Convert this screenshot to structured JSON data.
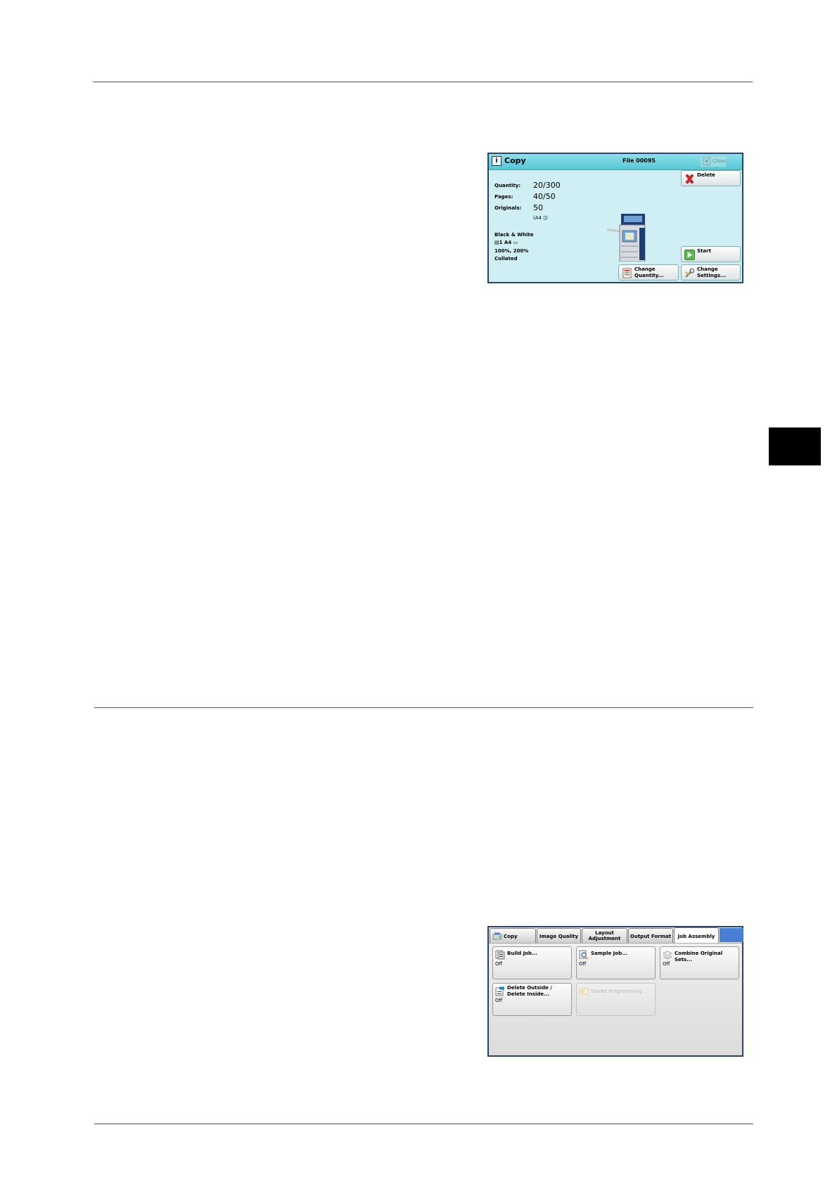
{
  "panel_job": {
    "title": "Copy",
    "file": "File 00095",
    "close_label": "Close",
    "fields": [
      {
        "label": "Quantity:",
        "value": "20/300"
      },
      {
        "label": "Pages:",
        "value": "40/50"
      },
      {
        "label": "Originals:",
        "value": "50"
      }
    ],
    "paper": "(A4 ▯)",
    "settings": [
      "Black & White",
      "▤1    A4 ▭",
      "100%, 200%",
      "Collated"
    ],
    "buttons": {
      "delete": "Delete",
      "start": "Start",
      "change_quantity": [
        "Change",
        "Quantity..."
      ],
      "change_settings": [
        "Change",
        "Settings..."
      ]
    }
  },
  "panel_tabs": {
    "tabs": [
      "Copy",
      "Image Quality",
      [
        "Layout",
        "Adjustment"
      ],
      "Output Format",
      "Job Assembly"
    ],
    "buttons": [
      {
        "label": "Build Job...",
        "state": "Off"
      },
      {
        "label": "Sample Job...",
        "state": "Off"
      },
      {
        "label": "Combine Original Sets...",
        "state": "Off"
      },
      {
        "label": [
          "Delete Outside /",
          "Delete Inside..."
        ],
        "state": "Off"
      },
      {
        "label": "Stored Programming...",
        "state": ""
      }
    ]
  }
}
